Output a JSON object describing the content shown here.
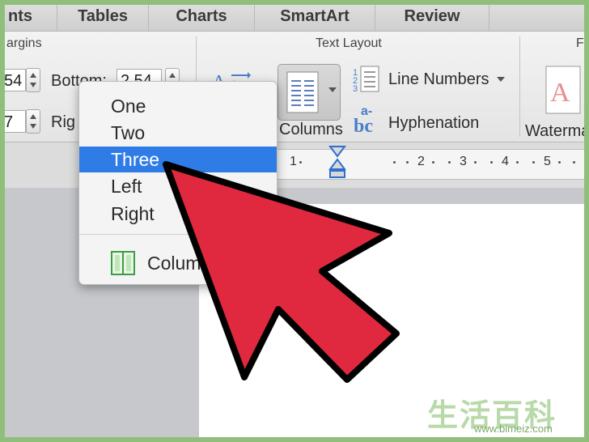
{
  "tabs": [
    "nts",
    "Tables",
    "Charts",
    "SmartArt",
    "Review"
  ],
  "ribbon": {
    "margins_label": "argins",
    "text_layout_label": "Text Layout",
    "right_group_label": "F",
    "left_value_1": "54",
    "left_value_2": "7",
    "bottom_label": "Bottom:",
    "bottom_value": "2.54",
    "right_label": "Rig",
    "columns_label": "Columns",
    "line_numbers_label": "Line Numbers",
    "hyphenation_label": "Hyphenation",
    "watermark_label": "Waterma",
    "hyphen_icon_top": "a-",
    "hyphen_icon_bottom": "bc"
  },
  "ruler": {
    "numbers": [
      "1",
      "2",
      "3",
      "4",
      "5"
    ]
  },
  "menu": {
    "items": [
      "One",
      "Two",
      "Three",
      "Left",
      "Right"
    ],
    "selected": "Three",
    "more_label": "Colum"
  },
  "colors": {
    "highlight": "#2f7ce6",
    "arrow": "#e0283e",
    "frame": "#8fbf7a"
  },
  "watermark": {
    "cn": "生活百科",
    "url": "www.bimeiz.com"
  }
}
